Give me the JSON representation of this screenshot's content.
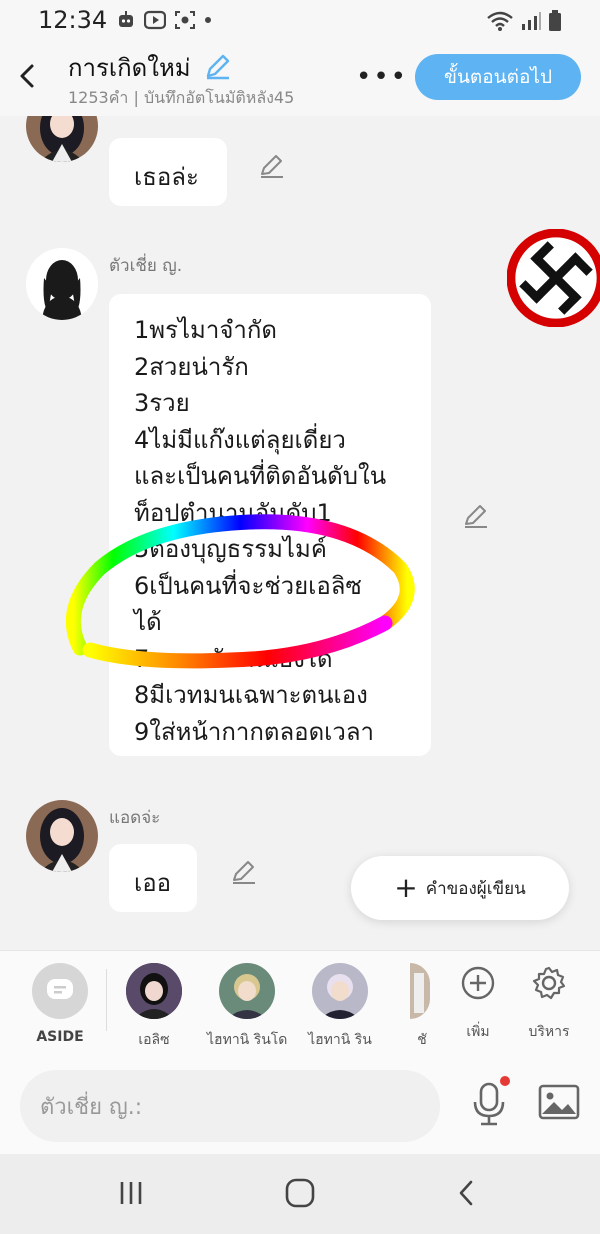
{
  "status_bar": {
    "time": "12:34"
  },
  "header": {
    "title": "การเกิดใหม่",
    "subtitle": "1253คำ | บันทึกอัตโนมัติหลัง45",
    "next_button": "ขั้นตอนต่อไป"
  },
  "messages": [
    {
      "sender": "",
      "text": "เธอล่ะ"
    },
    {
      "sender": "ตัวเชี่ย ญ.",
      "lines": [
        "1พรไมาจำกัด",
        "2สวยน่ารัก",
        "3รวย",
        "4ไม่มีแก๊งแต่ลุยเดี่ยว",
        "และเป็นคนที่ติดอันดับใน",
        "ท็อปตำนานอันดับ1",
        "5ต้องบุญธรรมไมค์",
        "6เป็นคนที่จะช่วยเอลิซ",
        "ได้",
        "7ขอพรกับตนเองได้",
        "8มีเวทมนเฉพาะตนเอง",
        "9ใส่หน้ากากตลอดเวลา"
      ]
    },
    {
      "sender": "แอดจ่ะ",
      "text": "เออ"
    }
  ],
  "author_word_button": "คำของผู้เขียน",
  "characters": [
    {
      "label": "ASIDE"
    },
    {
      "label": "เอลิซ"
    },
    {
      "label": "ไฮทานิ รินโด"
    },
    {
      "label": "ไฮทานิ ริน"
    },
    {
      "label": "ชั"
    },
    {
      "label": "เพิ่ม"
    },
    {
      "label": "บริหาร"
    }
  ],
  "input": {
    "placeholder": "ตัวเชี่ย ญ.:"
  },
  "colors": {
    "accent": "#5eb3f2",
    "background": "#f2f2f2",
    "bubble": "#ffffff"
  },
  "icons": [
    "back-arrow-icon",
    "pencil-icon",
    "more-icon",
    "plus-icon",
    "gear-icon",
    "mic-icon",
    "image-icon",
    "recents-icon",
    "home-icon",
    "back-icon"
  ]
}
